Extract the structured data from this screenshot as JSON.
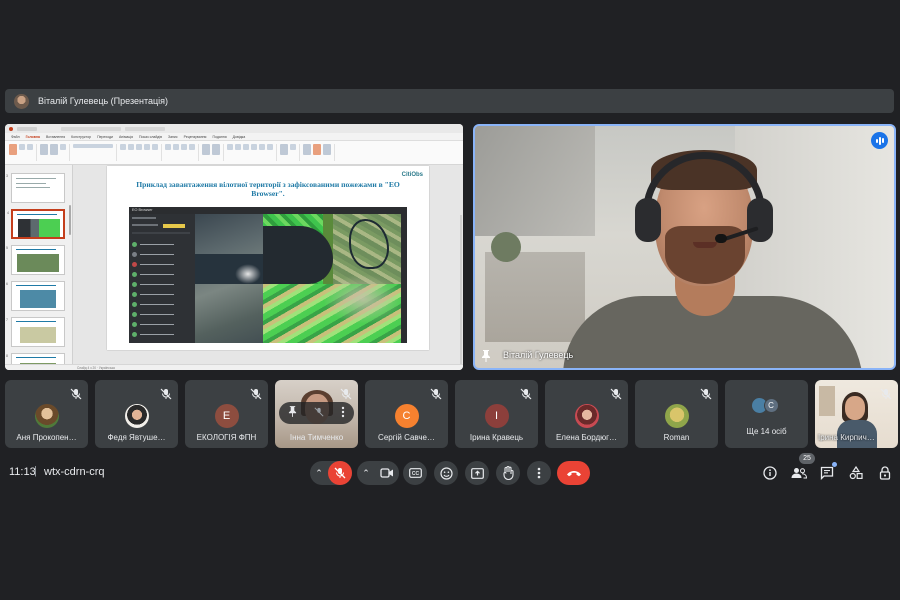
{
  "presenter_bar": {
    "name": "Віталій Гулевець (Презентація)"
  },
  "shared_screen": {
    "slide_title": "Приклад завантаження вілотної території з зафіксованими пожежами в \"EO Browser\".",
    "slide_logo": "CitiObs",
    "eo_header": "EO Browser",
    "ribbon_tabs": [
      "Файл",
      "Головна",
      "Вставлення",
      "Конструктор",
      "Переходи",
      "Анімація",
      "Показ слайдів",
      "Запис",
      "Рецензування",
      "Подання",
      "Довідка"
    ],
    "status_text": "Слайд 4 з 20 · Українська"
  },
  "main_video": {
    "name": "Віталій Гулевець"
  },
  "participants": [
    {
      "name": "Аня Прокопен…",
      "type": "avatar-photo",
      "color": "#b08a5a"
    },
    {
      "name": "Федя Явтуше…",
      "type": "avatar-photo",
      "color": "#e6e2dd"
    },
    {
      "name": "ЕКОЛОГІЯ ФПН",
      "type": "initial",
      "initial": "Е",
      "color": "#8d4d3f"
    },
    {
      "name": "Інна Тимченко",
      "type": "video"
    },
    {
      "name": "Сергій Савче…",
      "type": "initial",
      "initial": "С",
      "color": "#f6812f"
    },
    {
      "name": "Ірина Кравець",
      "type": "initial",
      "initial": "І",
      "color": "#8c3f3b"
    },
    {
      "name": "Елена Бордюг…",
      "type": "avatar-photo",
      "color": "#c84a52"
    },
    {
      "name": "Roman",
      "type": "avatar-photo",
      "color": "#c0b04a"
    },
    {
      "name": "Ще 14 осіб",
      "type": "more",
      "initial": "C"
    },
    {
      "name": "Ірина Кирпич…",
      "type": "video"
    }
  ],
  "bottom_bar": {
    "time": "11:13",
    "separator": "|",
    "meeting_code": "wtx-cdrn-crq",
    "people_count": "25"
  },
  "colors": {
    "accent_blue": "#8ab4f8",
    "hangup_red": "#ea4335",
    "bar_bg": "#3c4043",
    "page_bg": "#202124"
  }
}
